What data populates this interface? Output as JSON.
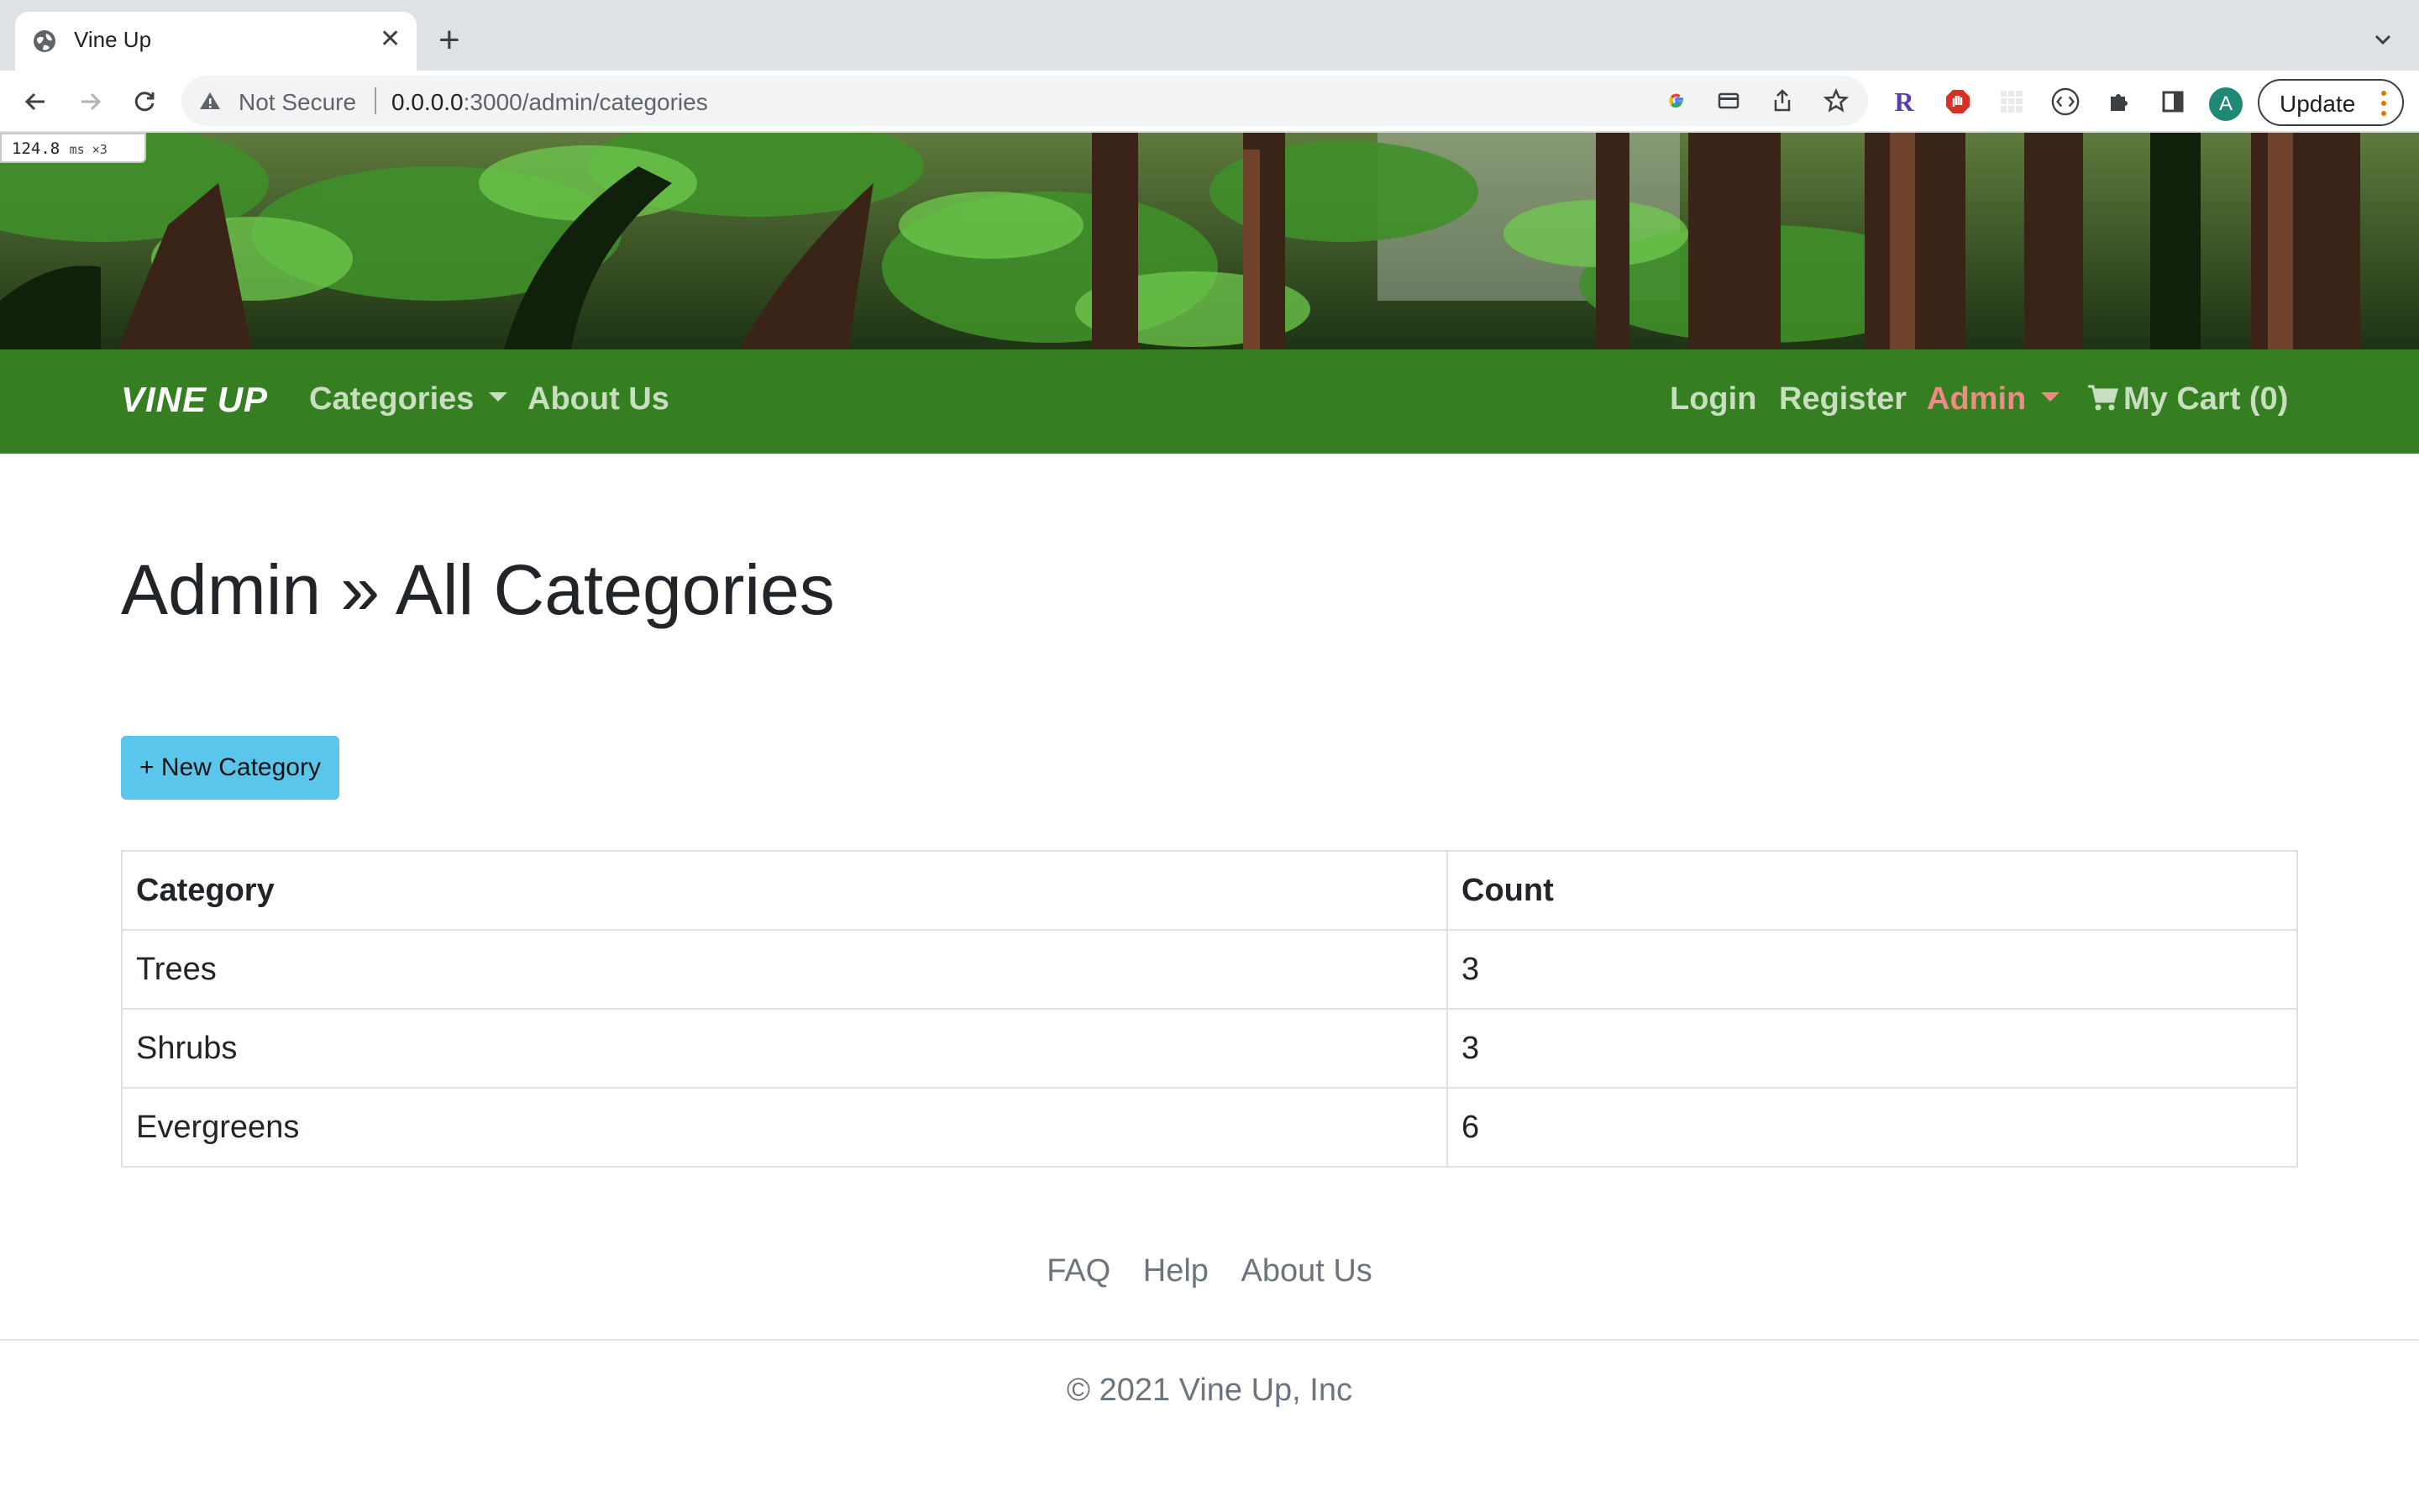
{
  "browser": {
    "tab_title": "Vine Up",
    "security_label": "Not Secure",
    "url_host": "0.0.0.0",
    "url_path": ":3000/admin/categories",
    "profile_initial": "A",
    "update_label": "Update",
    "perf_value": "124.8",
    "perf_unit": "ms ×3"
  },
  "navbar": {
    "brand": "VINE UP",
    "categories": "Categories",
    "about": "About Us",
    "login": "Login",
    "register": "Register",
    "admin": "Admin",
    "cart": "My Cart (0)"
  },
  "colors": {
    "navbar_bg": "#367e22",
    "nav_link": "#c7dfbe",
    "admin_link": "#f08a84",
    "button_bg": "#5bc6ec"
  },
  "page": {
    "title": "Admin » All Categories",
    "new_button": "+ New Category"
  },
  "table": {
    "headers": [
      "Category",
      "Count"
    ],
    "rows": [
      [
        "Trees",
        "3"
      ],
      [
        "Shrubs",
        "3"
      ],
      [
        "Evergreens",
        "6"
      ]
    ]
  },
  "footer": {
    "links": [
      "FAQ",
      "Help",
      "About Us"
    ],
    "copyright": "© 2021 Vine Up, Inc"
  }
}
